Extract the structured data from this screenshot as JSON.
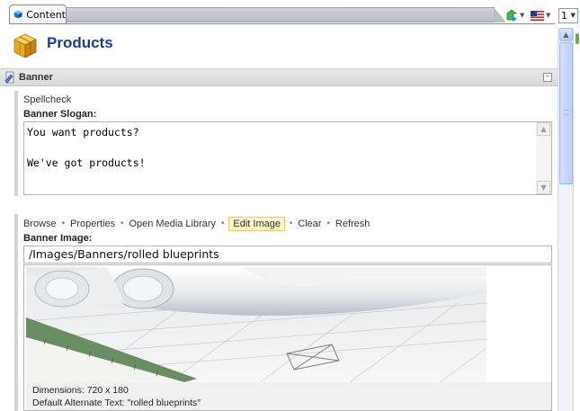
{
  "tabs": {
    "active": "Content"
  },
  "header": {
    "title": "Products"
  },
  "toolbar_right": {
    "pager_value": "1"
  },
  "section": {
    "title": "Banner"
  },
  "slogan_field": {
    "link": "Spellcheck",
    "label": "Banner Slogan:",
    "value": "You want products?\n\nWe've got products!"
  },
  "image_field": {
    "actions": [
      "Browse",
      "Properties",
      "Open Media Library",
      "Edit Image",
      "Clear",
      "Refresh"
    ],
    "highlighted_action": "Edit Image",
    "label": "Banner Image:",
    "path": "/Images/Banners/rolled blueprints",
    "dimensions": "Dimensions: 720 x 180",
    "alt_text": "Default Alternate Text: \"rolled blueprints\""
  },
  "icons": [
    "content-cube-icon",
    "publish-icon",
    "language-flag-icon",
    "products-boxes-icon",
    "banner-section-icon",
    "collapse-icon",
    "scroll-up-icon",
    "scroll-down-icon"
  ],
  "colors": {
    "title": "#1b3e8c",
    "section_bar": "#dcdcdc",
    "highlight": "#fdf3c7"
  }
}
